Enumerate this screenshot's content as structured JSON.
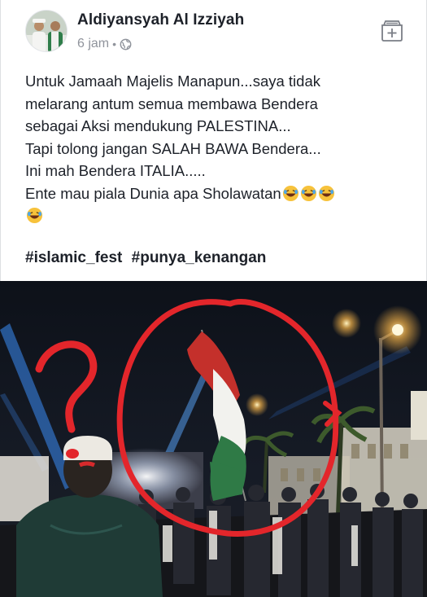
{
  "post": {
    "author": "Aldiyansyah Al Izziyah",
    "time": "6 jam",
    "separator": "•",
    "privacy_icon": "globe-icon",
    "save_icon": "save-plus-icon",
    "lines": [
      "Untuk Jamaah Majelis Manapun...saya tidak",
      "melarang antum semua membawa Bendera",
      "sebagai Aksi mendukung PALESTINA...",
      "Tapi tolong jangan SALAH BAWA Bendera...",
      "Ini mah Bendera ITALIA.....",
      "Ente mau piala Dunia apa Sholawatan"
    ],
    "emoji": "laughing-face-emoji",
    "hashtags": [
      "#islamic_fest",
      "#punya_kenangan"
    ]
  },
  "photo": {
    "question_mark": "?",
    "colors": {
      "annotation": "#e3262b",
      "sky": "#121620",
      "flag_red": "#c4302b",
      "flag_white": "#f2f2ee",
      "flag_green": "#2f7a46"
    }
  }
}
